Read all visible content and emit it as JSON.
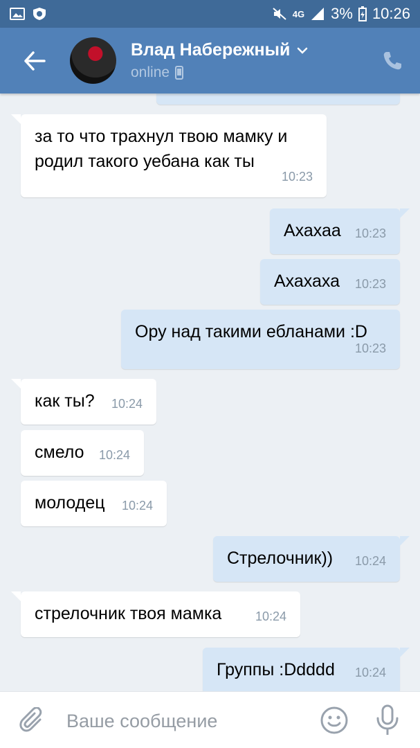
{
  "status_bar": {
    "network": "4G",
    "battery": "3%",
    "time": "10:26"
  },
  "header": {
    "name": "Влад Набережный",
    "status": "online"
  },
  "messages": [
    {
      "dir": "out",
      "text": "",
      "time": ""
    },
    {
      "dir": "in",
      "text": "за то что трахнул твою мамку и родил такого уебана как ты",
      "time": "10:23"
    },
    {
      "dir": "out",
      "text": "Ахахаа",
      "time": "10:23"
    },
    {
      "dir": "out",
      "text": "Ахахаха",
      "time": "10:23"
    },
    {
      "dir": "out",
      "text": "Ору над такими ебланами :D",
      "time": "10:23"
    },
    {
      "dir": "in",
      "text": "как ты?",
      "time": "10:24"
    },
    {
      "dir": "in",
      "text": "смело",
      "time": "10:24"
    },
    {
      "dir": "in",
      "text": "молодец",
      "time": "10:24"
    },
    {
      "dir": "out",
      "text": "Стрелочник))",
      "time": "10:24"
    },
    {
      "dir": "in",
      "text": "стрелочник твоя мамка",
      "time": "10:24"
    },
    {
      "dir": "out",
      "text": "Группы :Ddddd",
      "time": "10:24"
    }
  ],
  "composer": {
    "placeholder": "Ваше сообщение"
  },
  "icons": {
    "back": "arrow-left-icon",
    "dropdown": "chevron-down-icon",
    "mobile": "mobile-phone-icon",
    "call": "phone-icon",
    "attach": "paperclip-icon",
    "sticker": "smiley-icon",
    "mic": "microphone-icon"
  },
  "colors": {
    "header": "#5181b8",
    "status_bar": "#3f6a98",
    "incoming": "#ffffff",
    "outgoing": "#d6e6f6",
    "background": "#ecf0f4"
  }
}
